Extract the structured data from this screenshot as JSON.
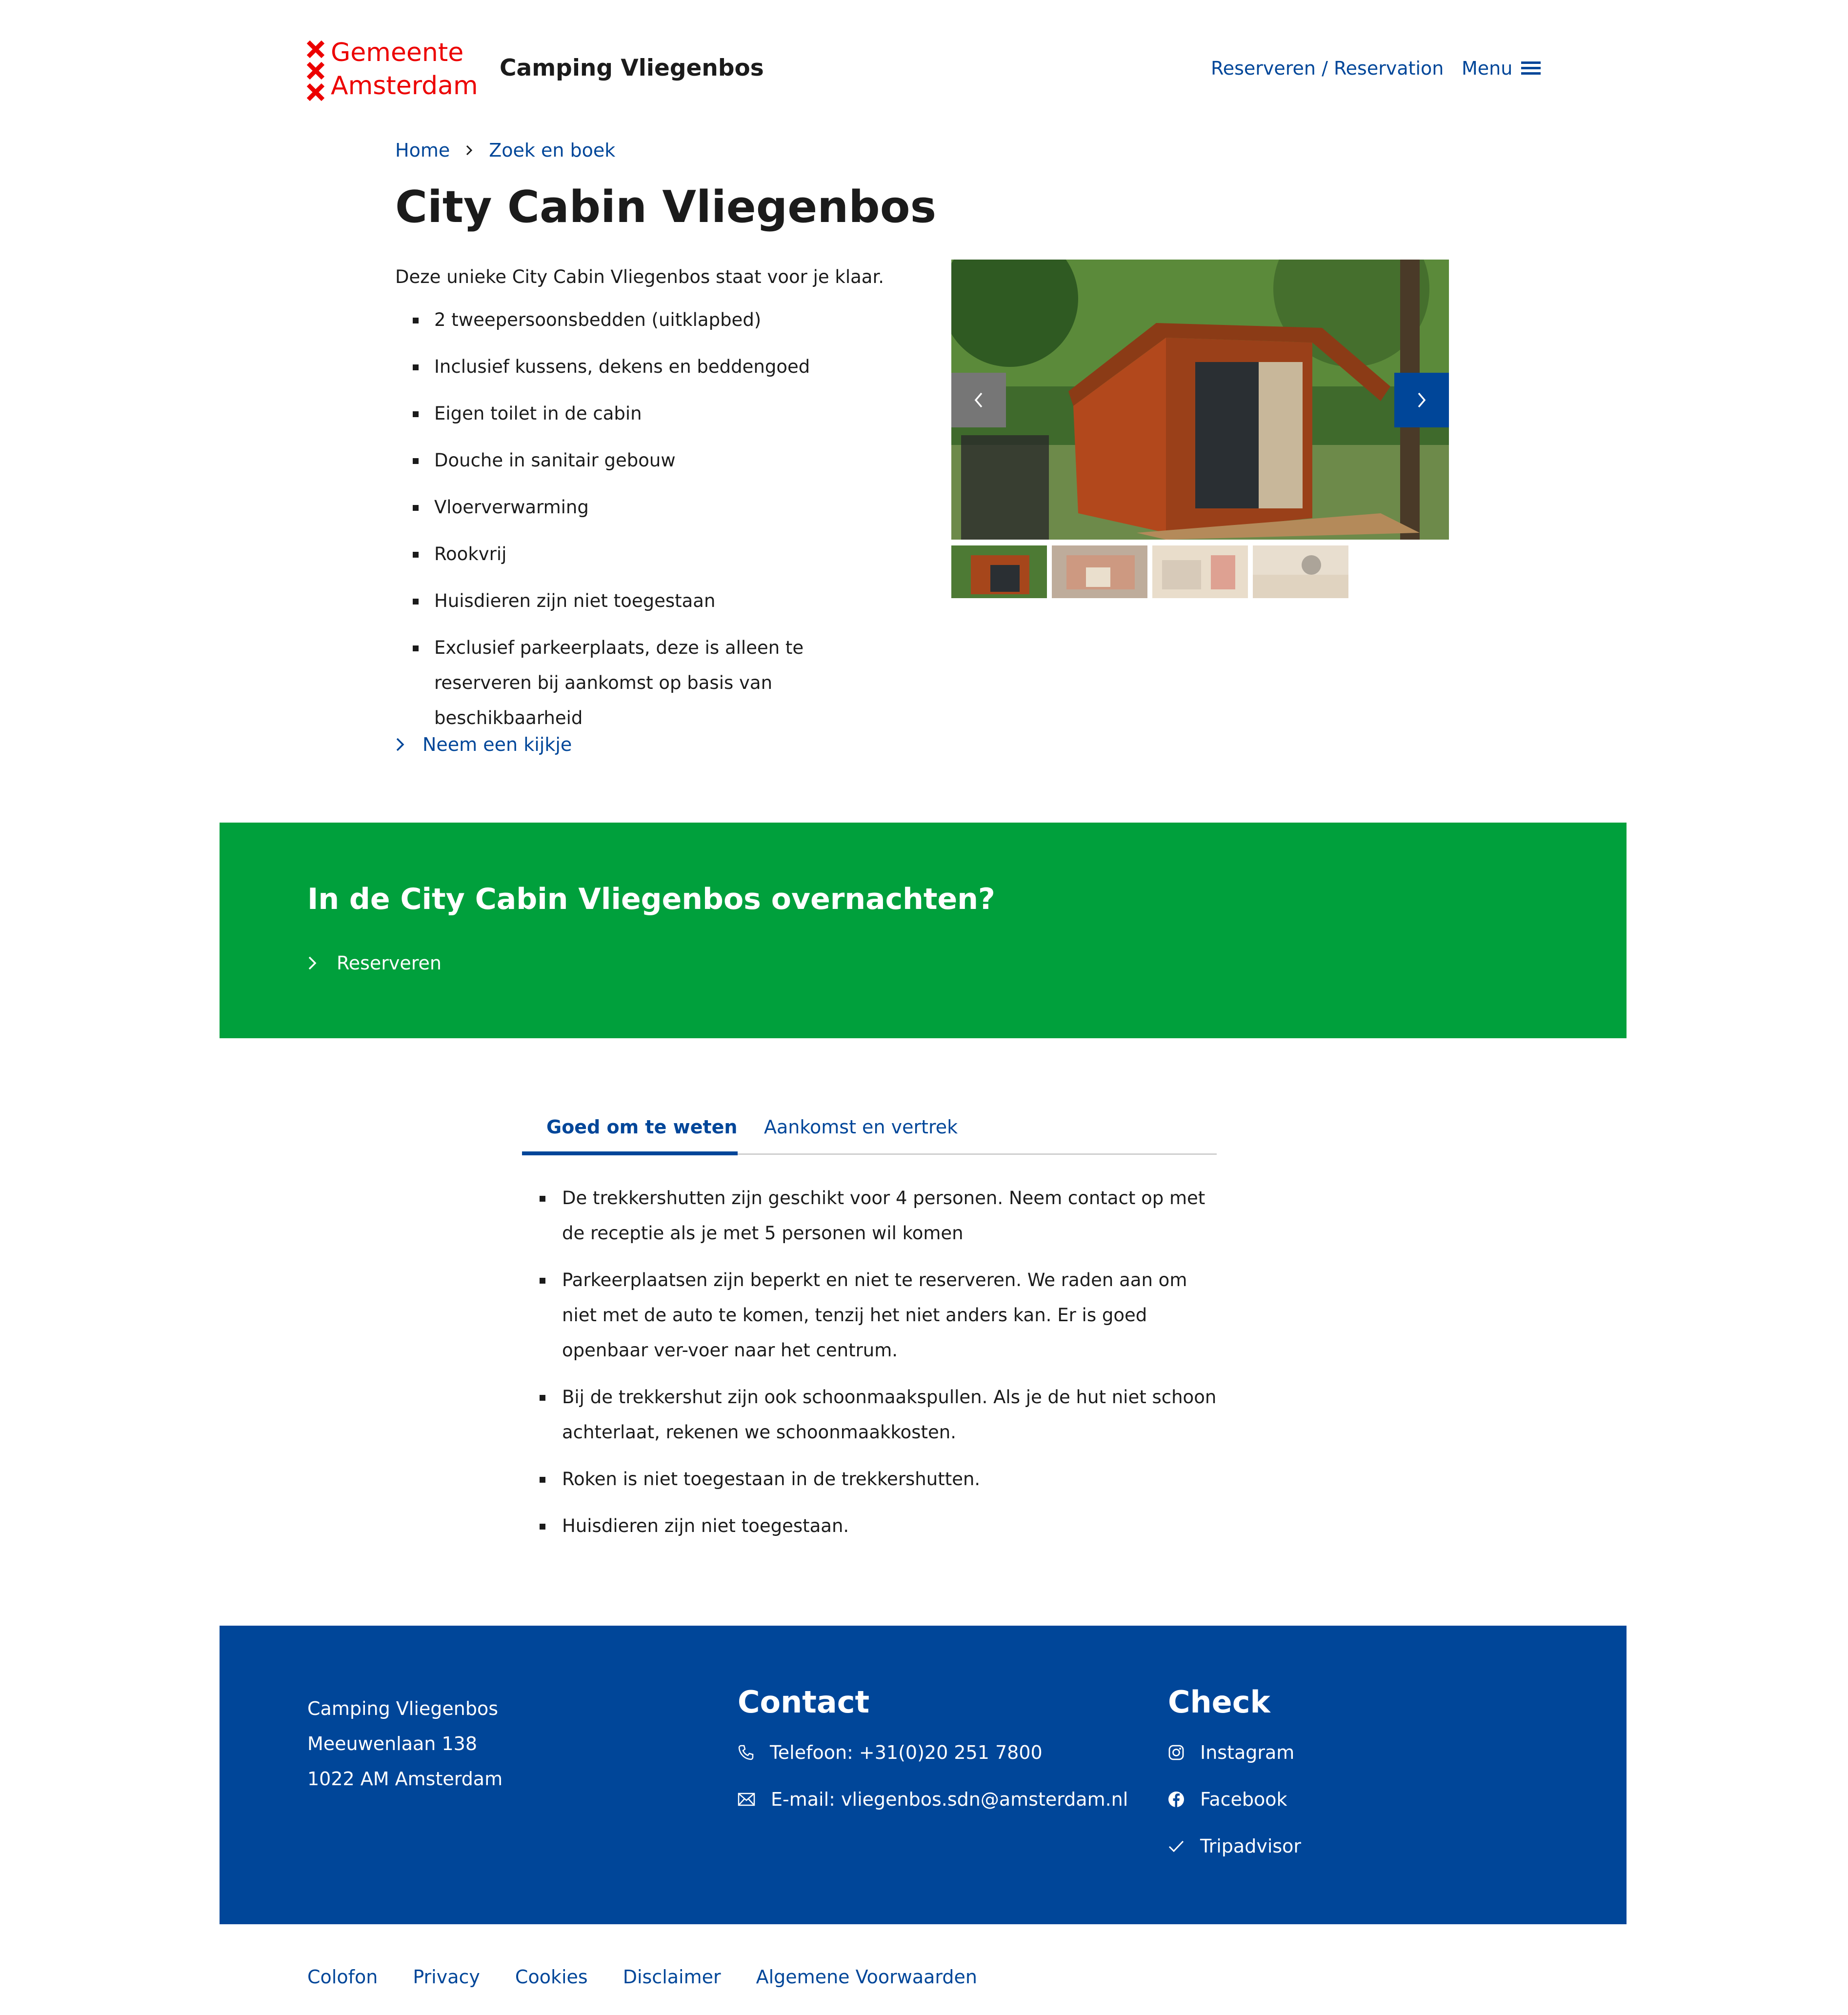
{
  "header": {
    "logo_lines": [
      "Gemeente",
      "Amsterdam"
    ],
    "site_name": "Camping Vliegenbos",
    "nav_reserve": "Reserveren / Reservation",
    "nav_menu": "Menu"
  },
  "breadcrumb": {
    "home": "Home",
    "current": "Zoek en boek"
  },
  "page_title": "City Cabin Vliegenbos",
  "intro": "Deze unieke City Cabin Vliegenbos staat voor je klaar.",
  "features": [
    "2 tweepersoonsbedden (uitklapbed)",
    "Inclusief kussens, dekens en beddengoed",
    "Eigen toilet in de cabin",
    "Douche in sanitair gebouw",
    "Vloerverwarming",
    "Rookvrij",
    "Huisdieren zijn niet toegestaan",
    "Exclusief parkeerplaats, deze is alleen te reserveren bij aankomst op basis van beschikbaarheid"
  ],
  "more_link": "Neem een kijkje",
  "cta": {
    "title": "In de City Cabin Vliegenbos overnachten?",
    "link": "Reserveren"
  },
  "tabs": {
    "active": "Goed om te weten",
    "second": "Aankomst en vertrek"
  },
  "info": [
    "De trekkershutten zijn geschikt voor 4 personen. Neem contact op met de receptie als je met 5 personen wil komen",
    "Parkeerplaatsen zijn beperkt en niet te reserveren. We raden aan om niet met de auto te komen, tenzij het niet anders kan. Er is goed openbaar ver-voer naar het centrum.",
    "Bij de trekkershut zijn ook schoonmaakspullen. Als je de hut niet schoon achterlaat, rekenen we schoonmaakkosten.",
    "Roken is niet toegestaan in de trekkershutten.",
    "Huisdieren zijn niet toegestaan."
  ],
  "footer": {
    "address": [
      "Camping Vliegenbos",
      "Meeuwenlaan 138",
      "1022 AM Amsterdam"
    ],
    "contact_title": "Contact",
    "phone": "Telefoon: +31(0)20 251 7800",
    "email": "E-mail: vliegenbos.sdn@amsterdam.nl",
    "check_title": "Check",
    "instagram": "Instagram",
    "facebook": "Facebook",
    "tripadvisor": "Tripadvisor"
  },
  "bottom_links": [
    "Colofon",
    "Privacy",
    "Cookies",
    "Disclaimer",
    "Algemene Voorwaarden"
  ],
  "colors": {
    "brand_red": "#ec0000",
    "link_blue": "#004699",
    "cta_green": "#00a03c",
    "footer_blue": "#004699"
  },
  "icons": [
    "amsterdam-cross-icon",
    "hamburger-icon",
    "chevron-right-icon",
    "chevron-left-icon",
    "phone-icon",
    "mail-icon",
    "instagram-icon",
    "facebook-icon",
    "check-icon"
  ]
}
